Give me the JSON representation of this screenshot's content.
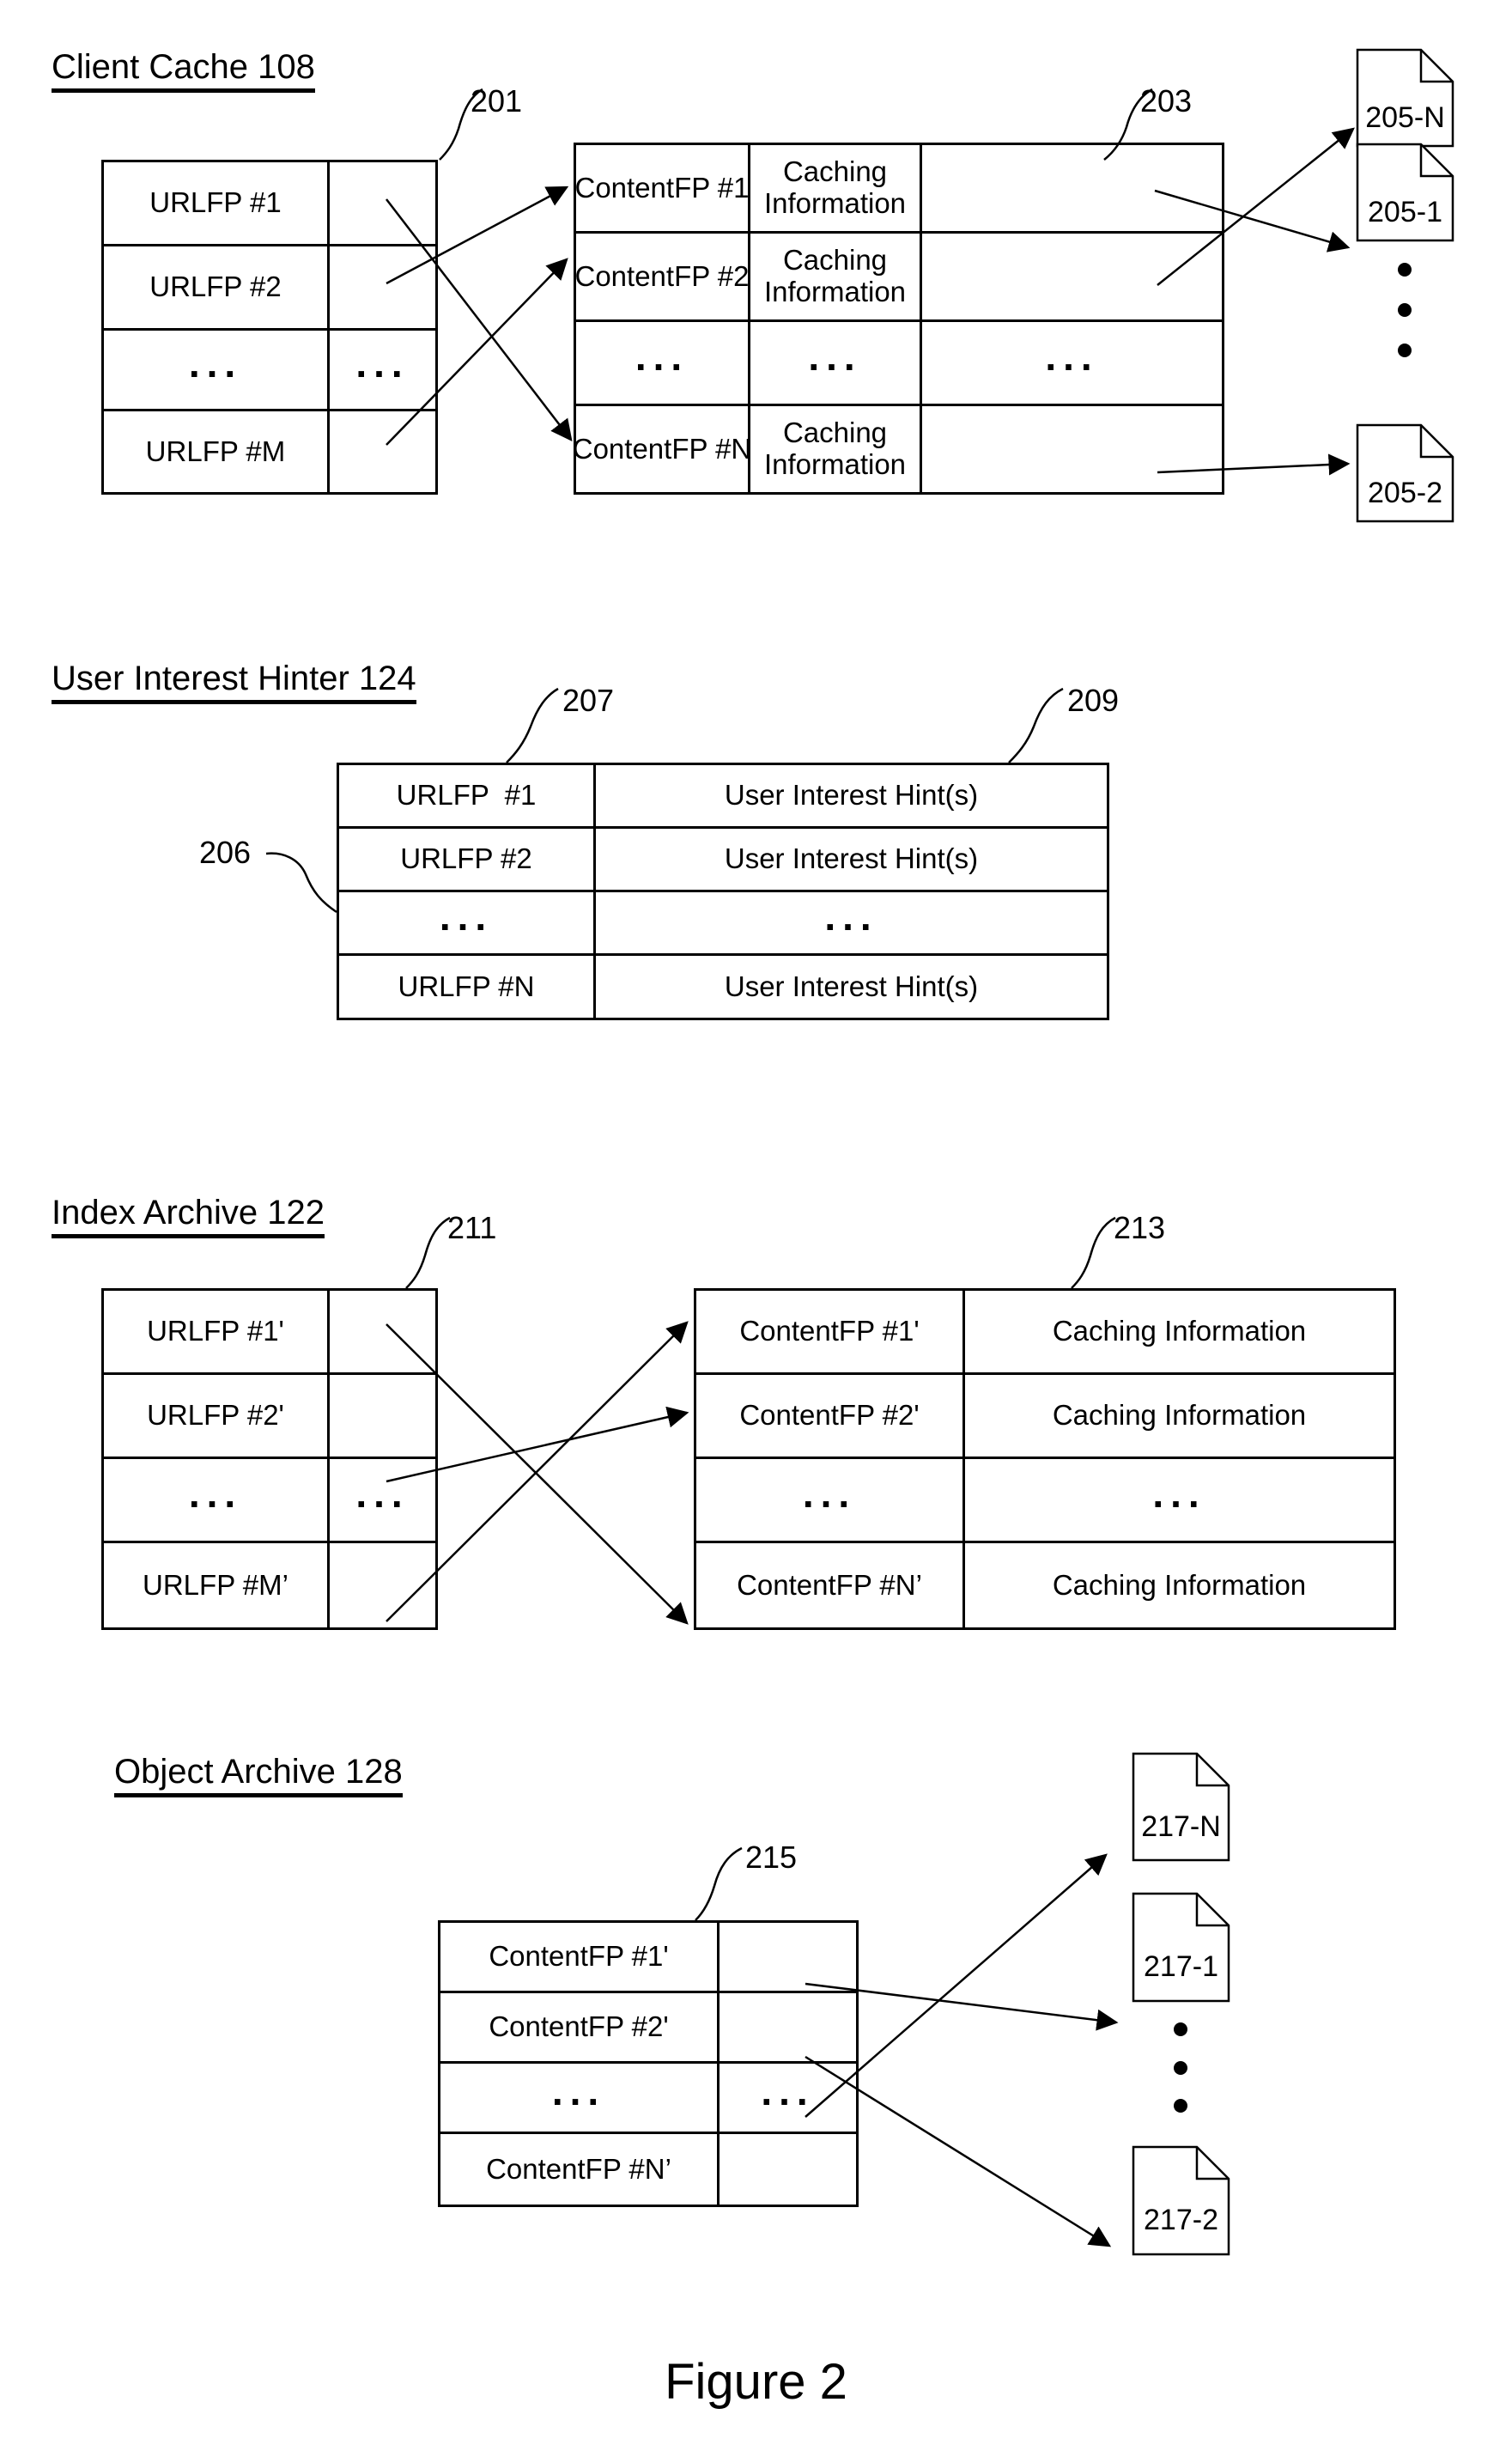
{
  "figure": {
    "caption": "Figure 2"
  },
  "sections": [
    {
      "id": "client-cache",
      "heading": "Client Cache 108",
      "refs": {
        "left_table": "201",
        "right_table": "203"
      },
      "left_table": {
        "rows": [
          {
            "cells": [
              "URLFP #1",
              ""
            ]
          },
          {
            "cells": [
              "URLFP #2",
              ""
            ]
          },
          {
            "cells": [
              "...",
              "..."
            ]
          },
          {
            "cells": [
              "URLFP #M",
              ""
            ]
          }
        ]
      },
      "right_table": {
        "rows": [
          {
            "cells": [
              "ContentFP #1",
              "Caching\nInformation",
              ""
            ]
          },
          {
            "cells": [
              "ContentFP #2",
              "Caching\nInformation",
              ""
            ]
          },
          {
            "cells": [
              "...",
              "...",
              "..."
            ]
          },
          {
            "cells": [
              "ContentFP #N",
              "Caching\nInformation",
              ""
            ]
          }
        ]
      },
      "documents": [
        {
          "label": "205-N"
        },
        {
          "label": "205-1"
        },
        {
          "label": "205-2"
        }
      ]
    },
    {
      "id": "user-interest-hinter",
      "heading": "User Interest Hinter 124",
      "refs": {
        "table": "206",
        "col1": "207",
        "col2": "209"
      },
      "table": {
        "rows": [
          {
            "cells": [
              "URLFP  #1",
              "User Interest Hint(s)"
            ]
          },
          {
            "cells": [
              "URLFP #2",
              "User Interest Hint(s)"
            ]
          },
          {
            "cells": [
              "...",
              "..."
            ]
          },
          {
            "cells": [
              "URLFP #N",
              "User Interest Hint(s)"
            ]
          }
        ]
      }
    },
    {
      "id": "index-archive",
      "heading": "Index Archive 122",
      "refs": {
        "left_table": "211",
        "right_table": "213"
      },
      "left_table": {
        "rows": [
          {
            "cells": [
              "URLFP #1'",
              ""
            ]
          },
          {
            "cells": [
              "URLFP #2'",
              ""
            ]
          },
          {
            "cells": [
              "...",
              "..."
            ]
          },
          {
            "cells": [
              "URLFP #M’",
              ""
            ]
          }
        ]
      },
      "right_table": {
        "rows": [
          {
            "cells": [
              "ContentFP #1'",
              "Caching Information"
            ]
          },
          {
            "cells": [
              "ContentFP #2'",
              "Caching Information"
            ]
          },
          {
            "cells": [
              "...",
              "..."
            ]
          },
          {
            "cells": [
              "ContentFP #N’",
              "Caching Information"
            ]
          }
        ]
      }
    },
    {
      "id": "object-archive",
      "heading": "Object Archive 128",
      "refs": {
        "table": "215"
      },
      "table": {
        "rows": [
          {
            "cells": [
              "ContentFP #1'",
              ""
            ]
          },
          {
            "cells": [
              "ContentFP #2'",
              ""
            ]
          },
          {
            "cells": [
              "...",
              "..."
            ]
          },
          {
            "cells": [
              "ContentFP #N’",
              ""
            ]
          }
        ]
      },
      "documents": [
        {
          "label": "217-N"
        },
        {
          "label": "217-1"
        },
        {
          "label": "217-2"
        }
      ]
    }
  ]
}
